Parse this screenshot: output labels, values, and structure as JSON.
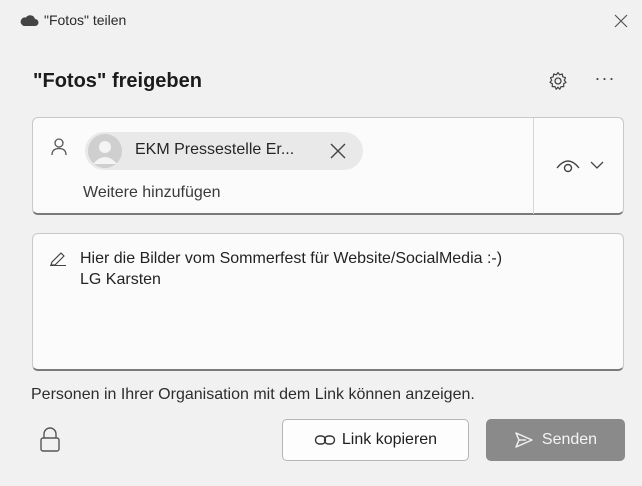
{
  "window": {
    "title": "\"Fotos\" teilen",
    "icon": "onedrive-cloud-icon"
  },
  "header": {
    "title": "\"Fotos\" freigeben",
    "settings_icon": "gear-icon",
    "more_label": "···"
  },
  "recipients": {
    "person_icon": "person-icon",
    "chips": [
      {
        "name": "EKM Pressestelle Er...",
        "avatar_icon": "avatar-placeholder-icon"
      }
    ],
    "add_more_placeholder": "Weitere hinzufügen",
    "permission_icon": "eye-icon"
  },
  "message": {
    "text": "Hier die Bilder vom Sommerfest für Website/SocialMedia :-)\nLG Karsten",
    "icon": "pencil-icon"
  },
  "info_text": "Personen in Ihrer Organisation mit dem Link können anzeigen.",
  "actions": {
    "copy_link_label": "Link kopieren",
    "send_label": "Senden"
  },
  "colors": {
    "background": "#f1f1f1",
    "send_button": "#8a8a8a",
    "field_bg": "#fbfbfb"
  }
}
